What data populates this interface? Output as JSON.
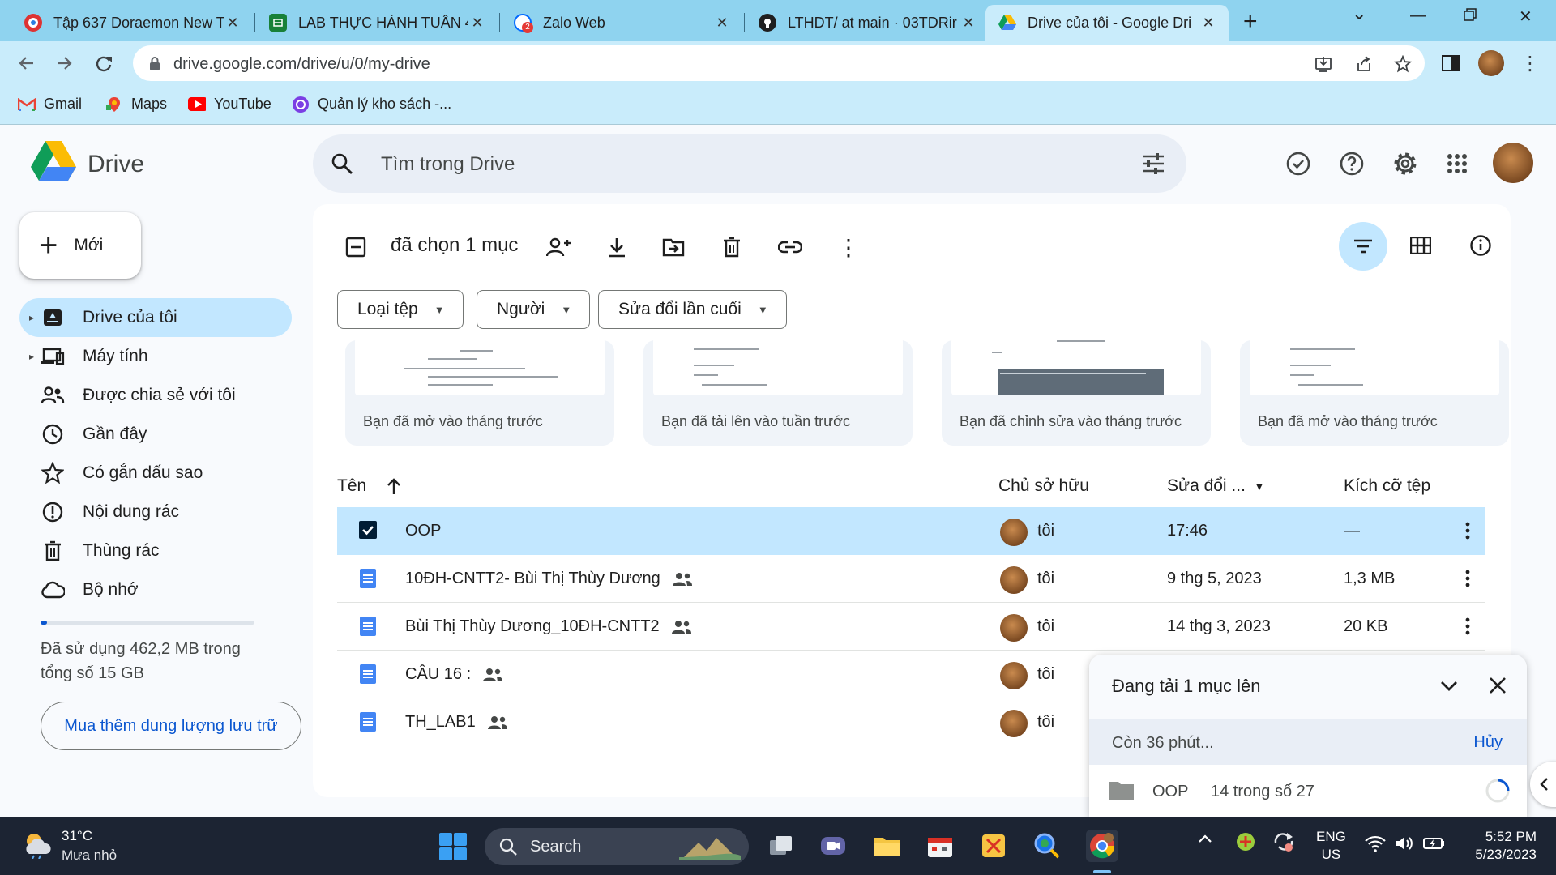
{
  "browser": {
    "tabs": [
      {
        "title": "Tập 637 Doraemon New T",
        "active": false
      },
      {
        "title": "LAB THỰC HÀNH TUẦN 4",
        "active": false
      },
      {
        "title": "Zalo Web",
        "active": false
      },
      {
        "title": "LTHDT/ at main · 03TDRir",
        "active": false
      },
      {
        "title": "Drive của tôi - Google Dri",
        "active": true
      }
    ],
    "url": "drive.google.com/drive/u/0/my-drive",
    "bookmarks": [
      "Gmail",
      "Maps",
      "YouTube",
      "Quản lý kho sách -..."
    ],
    "zalo_badge": "2"
  },
  "drive": {
    "app_name": "Drive",
    "search_placeholder": "Tìm trong Drive",
    "new_button": "Mới",
    "nav": [
      {
        "label": "Drive của tôi",
        "icon": "my-drive-icon",
        "active": true
      },
      {
        "label": "Máy tính",
        "icon": "computer-icon",
        "active": false
      },
      {
        "label": "Được chia sẻ với tôi",
        "icon": "shared-people-icon",
        "active": false
      },
      {
        "label": "Gần đây",
        "icon": "clock-icon",
        "active": false
      },
      {
        "label": "Có gắn dấu sao",
        "icon": "star-icon",
        "active": false
      },
      {
        "label": "Nội dung rác",
        "icon": "spam-icon",
        "active": false
      },
      {
        "label": "Thùng rác",
        "icon": "trash-icon",
        "active": false
      },
      {
        "label": "Bộ nhớ",
        "icon": "cloud-icon",
        "active": false
      }
    ],
    "storage": {
      "text": "Đã sử dụng 462,2 MB trong tổng số 15 GB",
      "used_fraction": 0.03,
      "buy_button": "Mua thêm dung lượng lưu trữ"
    },
    "selection": {
      "label": "đã chọn 1 mục"
    },
    "filters": [
      "Loại tệp",
      "Người",
      "Sửa đổi lần cuối"
    ],
    "suggested": [
      {
        "label": "Bạn đã mở vào tháng trước"
      },
      {
        "label": "Bạn đã tải lên vào tuần trước"
      },
      {
        "label": "Bạn đã chỉnh sửa vào tháng trước"
      },
      {
        "label": "Bạn đã mở vào tháng trước"
      }
    ],
    "columns": {
      "name": "Tên",
      "owner": "Chủ sở hữu",
      "modified": "Sửa đổi ...",
      "size": "Kích cỡ tệp"
    },
    "files": [
      {
        "name": "OOP",
        "type": "folder",
        "shared": false,
        "owner": "tôi",
        "modified": "17:46",
        "size": "—",
        "selected": true
      },
      {
        "name": "10ĐH-CNTT2- Bùi Thị Thùy Dương",
        "type": "doc",
        "shared": true,
        "owner": "tôi",
        "modified": "9 thg 5, 2023",
        "size": "1,3 MB",
        "selected": false
      },
      {
        "name": "Bùi Thị Thùy Dương_10ĐH-CNTT2",
        "type": "doc",
        "shared": true,
        "owner": "tôi",
        "modified": "14 thg 3, 2023",
        "size": "20 KB",
        "selected": false
      },
      {
        "name": "CÂU 16 :",
        "type": "doc",
        "shared": true,
        "owner": "tôi",
        "modified": "",
        "size": "",
        "selected": false
      },
      {
        "name": "TH_LAB1",
        "type": "doc",
        "shared": true,
        "owner": "tôi",
        "modified": "",
        "size": "",
        "selected": false
      }
    ],
    "upload": {
      "title": "Đang tải 1 mục lên",
      "remaining": "Còn 36 phút...",
      "cancel": "Hủy",
      "item_name": "OOP",
      "item_progress": "14 trong số 27"
    }
  },
  "taskbar": {
    "weather_temp": "31°C",
    "weather_desc": "Mưa nhỏ",
    "search_label": "Search",
    "lang_line1": "ENG",
    "lang_line2": "US",
    "time": "5:52 PM",
    "date": "5/23/2023"
  }
}
